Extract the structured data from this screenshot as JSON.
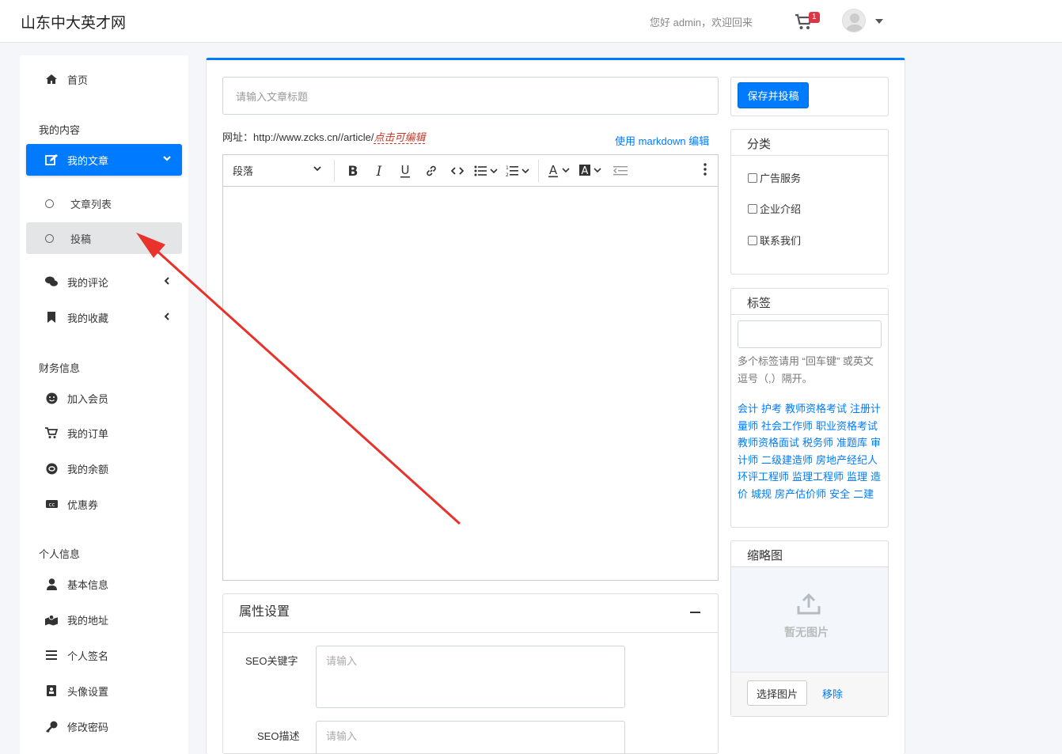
{
  "header": {
    "brand": "山东中大英才网",
    "greeting": "您好 admin，欢迎回来",
    "cart_count": "1"
  },
  "sidebar": {
    "home": "首页",
    "section_content": "我的内容",
    "my_articles": "我的文章",
    "article_list": "文章列表",
    "submit": "投稿",
    "my_comments": "我的评论",
    "my_favorites": "我的收藏",
    "section_finance": "财务信息",
    "join_member": "加入会员",
    "my_orders": "我的订单",
    "my_balance": "我的余额",
    "coupons": "优惠券",
    "section_personal": "个人信息",
    "basic_info": "基本信息",
    "my_address": "我的地址",
    "signature": "个人签名",
    "avatar_settings": "头像设置",
    "change_password": "修改密码"
  },
  "editor": {
    "title_placeholder": "请输入文章标题",
    "url_label": "网址：",
    "url_value": "http://www.zcks.cn//article/",
    "url_edit": "点击可编辑",
    "markdown_link": "使用 markdown 编辑",
    "paragraph": "段落"
  },
  "attributes": {
    "title": "属性设置",
    "seo_keywords_label": "SEO关键字",
    "seo_keywords_placeholder": "请输入",
    "seo_desc_label": "SEO描述",
    "seo_desc_placeholder": "请输入"
  },
  "right": {
    "save_button": "保存并投稿",
    "category_title": "分类",
    "categories": [
      "广告服务",
      "企业介绍",
      "联系我们"
    ],
    "tags_title": "标签",
    "tags_hint": "多个标签请用 “回车键” 或英文逗号（,）隔开。",
    "tags": [
      "会计",
      "护考",
      "教师资格考试",
      "注册计量师",
      "社会工作师",
      "职业资格考试",
      "教师资格面试",
      "税务师",
      "准题库",
      "审计师",
      "二级建造师",
      "房地产经纪人",
      "环评工程师",
      "监理工程师",
      "监理",
      "造价",
      "城规",
      "房产估价师",
      "安全",
      "二建"
    ],
    "thumb_title": "缩略图",
    "thumb_empty": "暂无图片",
    "pick_image": "选择图片",
    "remove": "移除"
  },
  "colors": {
    "primary": "#007bff",
    "annotation_arrow": "#e8322b"
  }
}
